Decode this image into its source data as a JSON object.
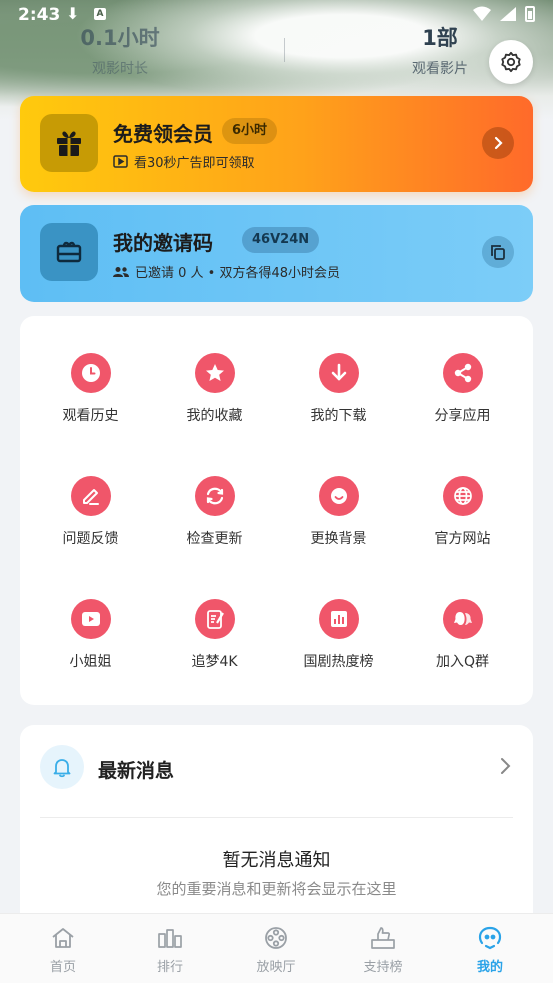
{
  "status_bar": {
    "time": "2:43",
    "download_glyph": "⬇",
    "a_glyph": "A"
  },
  "stats": [
    {
      "value": "0.1小时",
      "label": "观影时长"
    },
    {
      "value": "1部",
      "label": "观看影片"
    }
  ],
  "vip_card": {
    "title": "免费领会员",
    "badge": "6小时",
    "subtitle": "看30秒广告即可领取",
    "colors": [
      "#ffca0d",
      "#ff6a2a"
    ]
  },
  "invite_card": {
    "title": "我的邀请码",
    "badge": "46V24N",
    "subtitle": "已邀请 0 人 • 双方各得48小时会员",
    "colors": [
      "#5ebef4",
      "#7ccdf8"
    ]
  },
  "grid_items": [
    {
      "label": "观看历史",
      "icon": "clock-icon"
    },
    {
      "label": "我的收藏",
      "icon": "star-icon"
    },
    {
      "label": "我的下载",
      "icon": "download-icon"
    },
    {
      "label": "分享应用",
      "icon": "share-icon"
    },
    {
      "label": "问题反馈",
      "icon": "edit-icon"
    },
    {
      "label": "检查更新",
      "icon": "refresh-icon"
    },
    {
      "label": "更换背景",
      "icon": "smile-icon"
    },
    {
      "label": "官方网站",
      "icon": "globe-icon"
    },
    {
      "label": "小姐姐",
      "icon": "video-icon"
    },
    {
      "label": "追梦4K",
      "icon": "notepad-icon"
    },
    {
      "label": "国剧热度榜",
      "icon": "chart-icon"
    },
    {
      "label": "加入Q群",
      "icon": "group-icon"
    }
  ],
  "accent_color": "#f0566a",
  "messages": {
    "title": "最新消息",
    "empty_title": "暂无消息通知",
    "empty_subtitle": "您的重要消息和更新将会显示在这里"
  },
  "nav": [
    {
      "label": "首页",
      "icon": "home-icon"
    },
    {
      "label": "排行",
      "icon": "ranking-icon"
    },
    {
      "label": "放映厅",
      "icon": "film-reel-icon"
    },
    {
      "label": "支持榜",
      "icon": "thumbs-up-icon"
    },
    {
      "label": "我的",
      "icon": "profile-icon",
      "active": true
    }
  ],
  "nav_active_color": "#2aa3e8"
}
